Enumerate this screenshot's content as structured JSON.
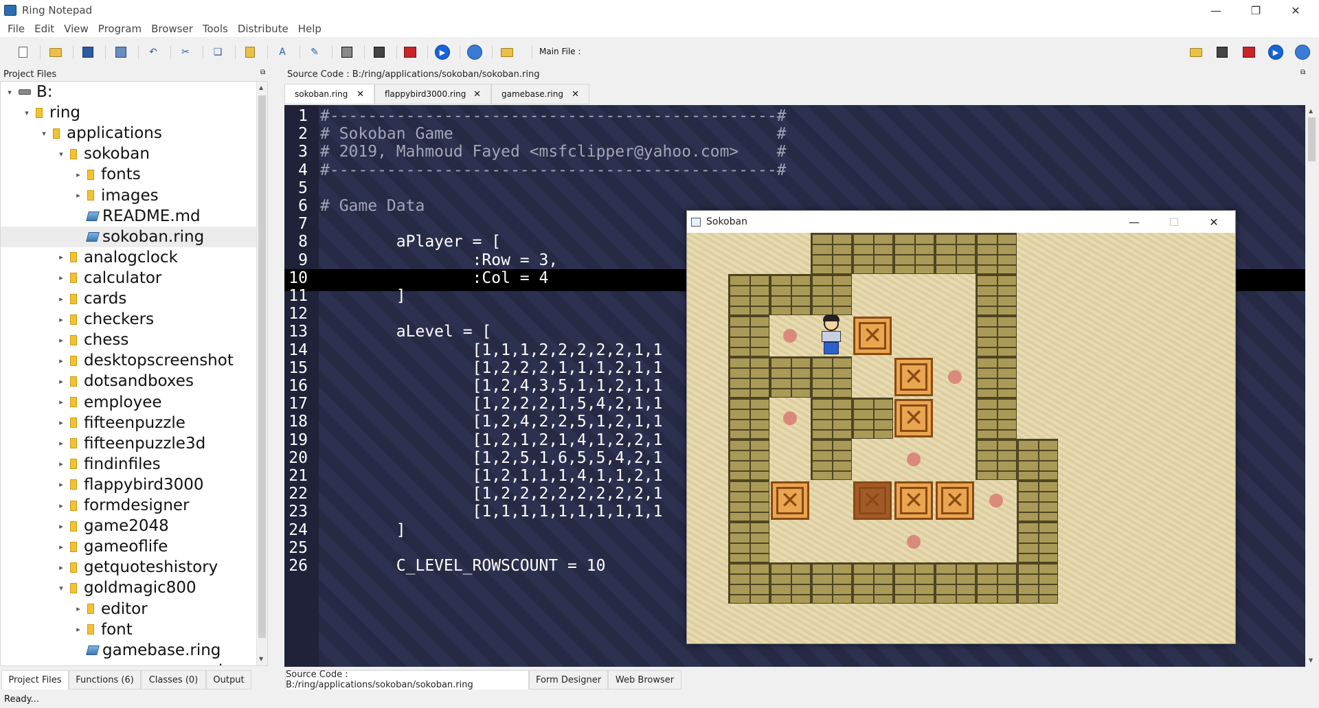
{
  "window": {
    "title": "Ring Notepad"
  },
  "menu": [
    "File",
    "Edit",
    "View",
    "Program",
    "Browser",
    "Tools",
    "Distribute",
    "Help"
  ],
  "toolbar": {
    "main_file_label": "Main File :"
  },
  "project_panel": {
    "title": "Project Files",
    "tree": [
      {
        "label": "B:",
        "depth": 0,
        "type": "drive",
        "expanded": true
      },
      {
        "label": "ring",
        "depth": 1,
        "type": "folder",
        "expanded": true
      },
      {
        "label": "applications",
        "depth": 2,
        "type": "folder",
        "expanded": true
      },
      {
        "label": "sokoban",
        "depth": 3,
        "type": "folder",
        "expanded": true
      },
      {
        "label": "fonts",
        "depth": 4,
        "type": "folder",
        "expanded": false
      },
      {
        "label": "images",
        "depth": 4,
        "type": "folder",
        "expanded": false
      },
      {
        "label": "README.md",
        "depth": 4,
        "type": "file"
      },
      {
        "label": "sokoban.ring",
        "depth": 4,
        "type": "file",
        "selected": true
      },
      {
        "label": "analogclock",
        "depth": 3,
        "type": "folder",
        "expanded": false
      },
      {
        "label": "calculator",
        "depth": 3,
        "type": "folder",
        "expanded": false
      },
      {
        "label": "cards",
        "depth": 3,
        "type": "folder",
        "expanded": false
      },
      {
        "label": "checkers",
        "depth": 3,
        "type": "folder",
        "expanded": false
      },
      {
        "label": "chess",
        "depth": 3,
        "type": "folder",
        "expanded": false
      },
      {
        "label": "desktopscreenshot",
        "depth": 3,
        "type": "folder",
        "expanded": false
      },
      {
        "label": "dotsandboxes",
        "depth": 3,
        "type": "folder",
        "expanded": false
      },
      {
        "label": "employee",
        "depth": 3,
        "type": "folder",
        "expanded": false
      },
      {
        "label": "fifteenpuzzle",
        "depth": 3,
        "type": "folder",
        "expanded": false
      },
      {
        "label": "fifteenpuzzle3d",
        "depth": 3,
        "type": "folder",
        "expanded": false
      },
      {
        "label": "findinfiles",
        "depth": 3,
        "type": "folder",
        "expanded": false
      },
      {
        "label": "flappybird3000",
        "depth": 3,
        "type": "folder",
        "expanded": false
      },
      {
        "label": "formdesigner",
        "depth": 3,
        "type": "folder",
        "expanded": false
      },
      {
        "label": "game2048",
        "depth": 3,
        "type": "folder",
        "expanded": false
      },
      {
        "label": "gameoflife",
        "depth": 3,
        "type": "folder",
        "expanded": false
      },
      {
        "label": "getquoteshistory",
        "depth": 3,
        "type": "folder",
        "expanded": false
      },
      {
        "label": "goldmagic800",
        "depth": 3,
        "type": "folder",
        "expanded": true
      },
      {
        "label": "editor",
        "depth": 4,
        "type": "folder",
        "expanded": false
      },
      {
        "label": "font",
        "depth": 4,
        "type": "folder",
        "expanded": false
      },
      {
        "label": "gamebase.ring",
        "depth": 4,
        "type": "file"
      },
      {
        "label": "gamecamera.ring",
        "depth": 4,
        "type": "file"
      }
    ]
  },
  "bottom_tabs_left": [
    "Project Files",
    "Functions (6)",
    "Classes (0)",
    "Output"
  ],
  "source_panel": {
    "title": "Source Code : B:/ring/applications/sokoban/sokoban.ring"
  },
  "editor_tabs": [
    "sokoban.ring",
    "flappybird3000.ring",
    "gamebase.ring"
  ],
  "code_lines": [
    {
      "n": "1",
      "text": "#-----------------------------------------------#",
      "comment": true
    },
    {
      "n": "2",
      "text": "# Sokoban Game                                  #",
      "comment": true
    },
    {
      "n": "3",
      "text": "# 2019, Mahmoud Fayed <msfclipper@yahoo.com>    #",
      "comment": true
    },
    {
      "n": "4",
      "text": "#-----------------------------------------------#",
      "comment": true
    },
    {
      "n": "5",
      "text": ""
    },
    {
      "n": "6",
      "text": "# Game Data",
      "comment": true
    },
    {
      "n": "7",
      "text": ""
    },
    {
      "n": "8",
      "text": "        aPlayer = ["
    },
    {
      "n": "9",
      "text": "                :Row = 3,"
    },
    {
      "n": "10",
      "text": "                :Col = 4",
      "current": true
    },
    {
      "n": "11",
      "text": "        ]"
    },
    {
      "n": "12",
      "text": ""
    },
    {
      "n": "13",
      "text": "        aLevel = ["
    },
    {
      "n": "14",
      "text": "                [1,1,1,2,2,2,2,2,1,1"
    },
    {
      "n": "15",
      "text": "                [1,2,2,2,1,1,1,2,1,1"
    },
    {
      "n": "16",
      "text": "                [1,2,4,3,5,1,1,2,1,1"
    },
    {
      "n": "17",
      "text": "                [1,2,2,2,1,5,4,2,1,1"
    },
    {
      "n": "18",
      "text": "                [1,2,4,2,2,5,1,2,1,1"
    },
    {
      "n": "19",
      "text": "                [1,2,1,2,1,4,1,2,2,1"
    },
    {
      "n": "20",
      "text": "                [1,2,5,1,6,5,5,4,2,1"
    },
    {
      "n": "21",
      "text": "                [1,2,1,1,1,4,1,1,2,1"
    },
    {
      "n": "22",
      "text": "                [1,2,2,2,2,2,2,2,2,1"
    },
    {
      "n": "23",
      "text": "                [1,1,1,1,1,1,1,1,1,1"
    },
    {
      "n": "24",
      "text": "        ]"
    },
    {
      "n": "25",
      "text": ""
    },
    {
      "n": "26",
      "text": "        C_LEVEL_ROWSCOUNT = 10"
    }
  ],
  "bottom_tabs_right": [
    "Source Code : B:/ring/applications/sokoban/sokoban.ring",
    "Form Designer",
    "Web Browser"
  ],
  "sokoban_window": {
    "title": "Sokoban",
    "grid": [
      "..WWWWW..",
      "WWW...W..",
      "W.P#..W..",
      "WWW.#.W..",
      "W.WW#.W..",
      "W.W...WW.",
      "W#.*##.W.",
      "W......W.",
      "WWWWWWWW."
    ],
    "goals": [
      [
        2,
        1
      ],
      [
        3,
        5
      ],
      [
        4,
        1
      ],
      [
        5,
        4
      ],
      [
        6,
        6
      ],
      [
        7,
        4
      ]
    ]
  },
  "status": {
    "text": "Ready..."
  }
}
